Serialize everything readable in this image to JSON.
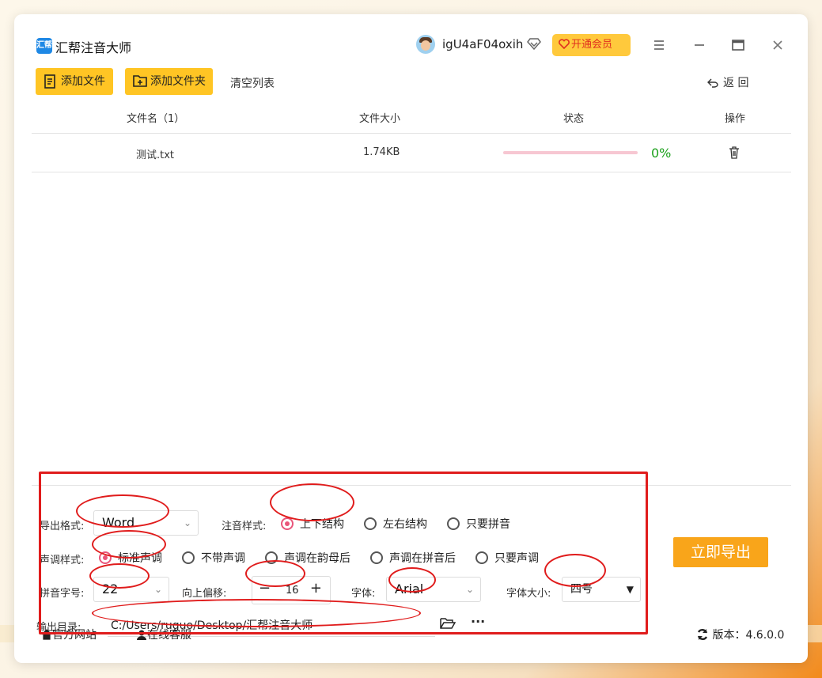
{
  "app": {
    "title": "汇帮注音大师",
    "logo_text": "汇帮",
    "username": "igU4aF04oxih",
    "vip_label": "开通会员"
  },
  "toolbar": {
    "add_file": "添加文件",
    "add_folder": "添加文件夹",
    "clear_list": "清空列表",
    "back": "返 回"
  },
  "table": {
    "headers": {
      "name": "文件名（1）",
      "size": "文件大小",
      "status": "状态",
      "action": "操作"
    },
    "rows": [
      {
        "name": "测试.txt",
        "size": "1.74KB",
        "progress_pct": 0,
        "progress_label": "0%"
      }
    ]
  },
  "settings": {
    "format_label": "导出格式:",
    "format_value": "Word",
    "annotation_label": "注音样式:",
    "annotation_options": [
      "上下结构",
      "左右结构",
      "只要拼音"
    ],
    "annotation_selected": 0,
    "tone_label": "声调样式:",
    "tone_options": [
      "标准声调",
      "不带声调",
      "声调在韵母后",
      "声调在拼音后",
      "只要声调"
    ],
    "tone_selected": 0,
    "pinyin_size_label": "拼音字号:",
    "pinyin_size_value": "22",
    "offset_label": "向上偏移:",
    "offset_value": "16",
    "font_label": "字体:",
    "font_value": "Arial",
    "font_size_label": "字体大小:",
    "font_size_value": "四号",
    "output_label": "输出目录:",
    "output_path": "C:/Users/ruguo/Desktop/汇帮注音大师",
    "more": "···"
  },
  "export_button": "立即导出",
  "footer": {
    "website": "官方网站",
    "support": "在线客服",
    "version": "版本：4.6.0.0"
  },
  "colors": {
    "accent": "#ffc524",
    "export": "#f9a51a",
    "progress": "#e9557a",
    "annotation": "#e01c1c"
  }
}
